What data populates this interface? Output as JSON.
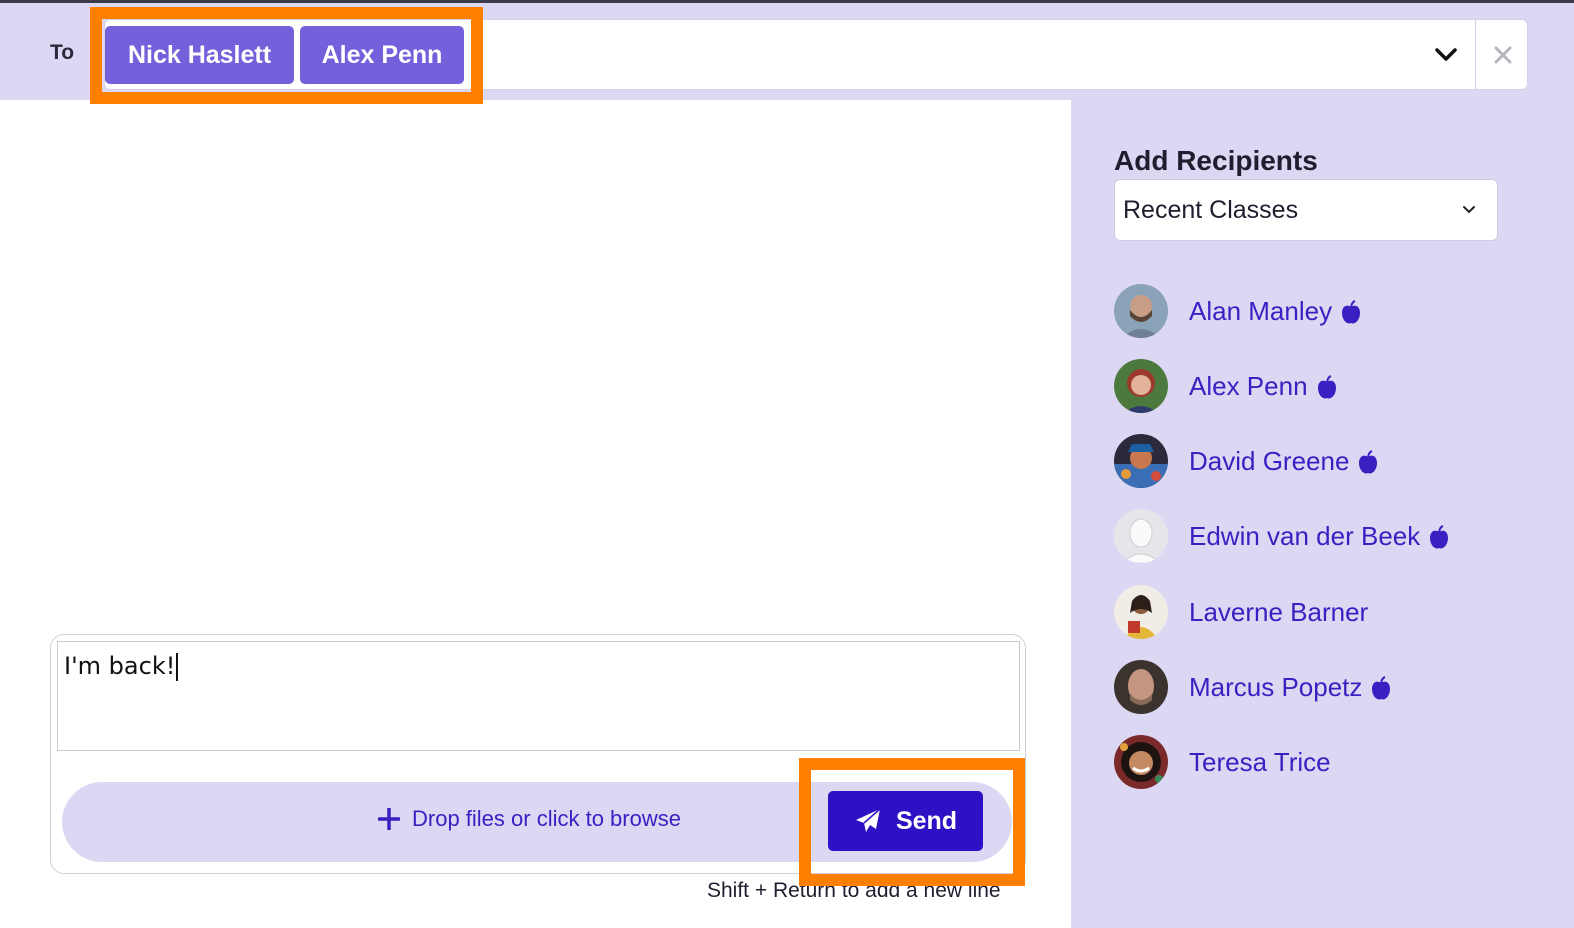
{
  "header": {
    "to_label": "To",
    "recipients": [
      {
        "label": "Nick Haslett"
      },
      {
        "label": "Alex Penn"
      }
    ]
  },
  "sidebar": {
    "title": "Add Recipients",
    "dropdown_selected": "Recent Classes",
    "people": [
      {
        "name": "Alan Manley",
        "teacher_icon": true
      },
      {
        "name": "Alex Penn",
        "teacher_icon": true
      },
      {
        "name": "David Greene",
        "teacher_icon": true
      },
      {
        "name": "Edwin van der Beek",
        "teacher_icon": true
      },
      {
        "name": "Laverne Barner",
        "teacher_icon": false
      },
      {
        "name": "Marcus Popetz",
        "teacher_icon": true
      },
      {
        "name": "Teresa Trice",
        "teacher_icon": false
      }
    ]
  },
  "composer": {
    "message": "I'm back!",
    "dropzone_label": "Drop files or click to browse",
    "send_label": "Send",
    "hint": "Shift + Return to add a new line"
  },
  "colors": {
    "accent": "#2f10c4",
    "chip": "#7560dc",
    "panel": "#dcd7f3",
    "link": "#3a1fc2",
    "highlight": "#ff8000"
  }
}
